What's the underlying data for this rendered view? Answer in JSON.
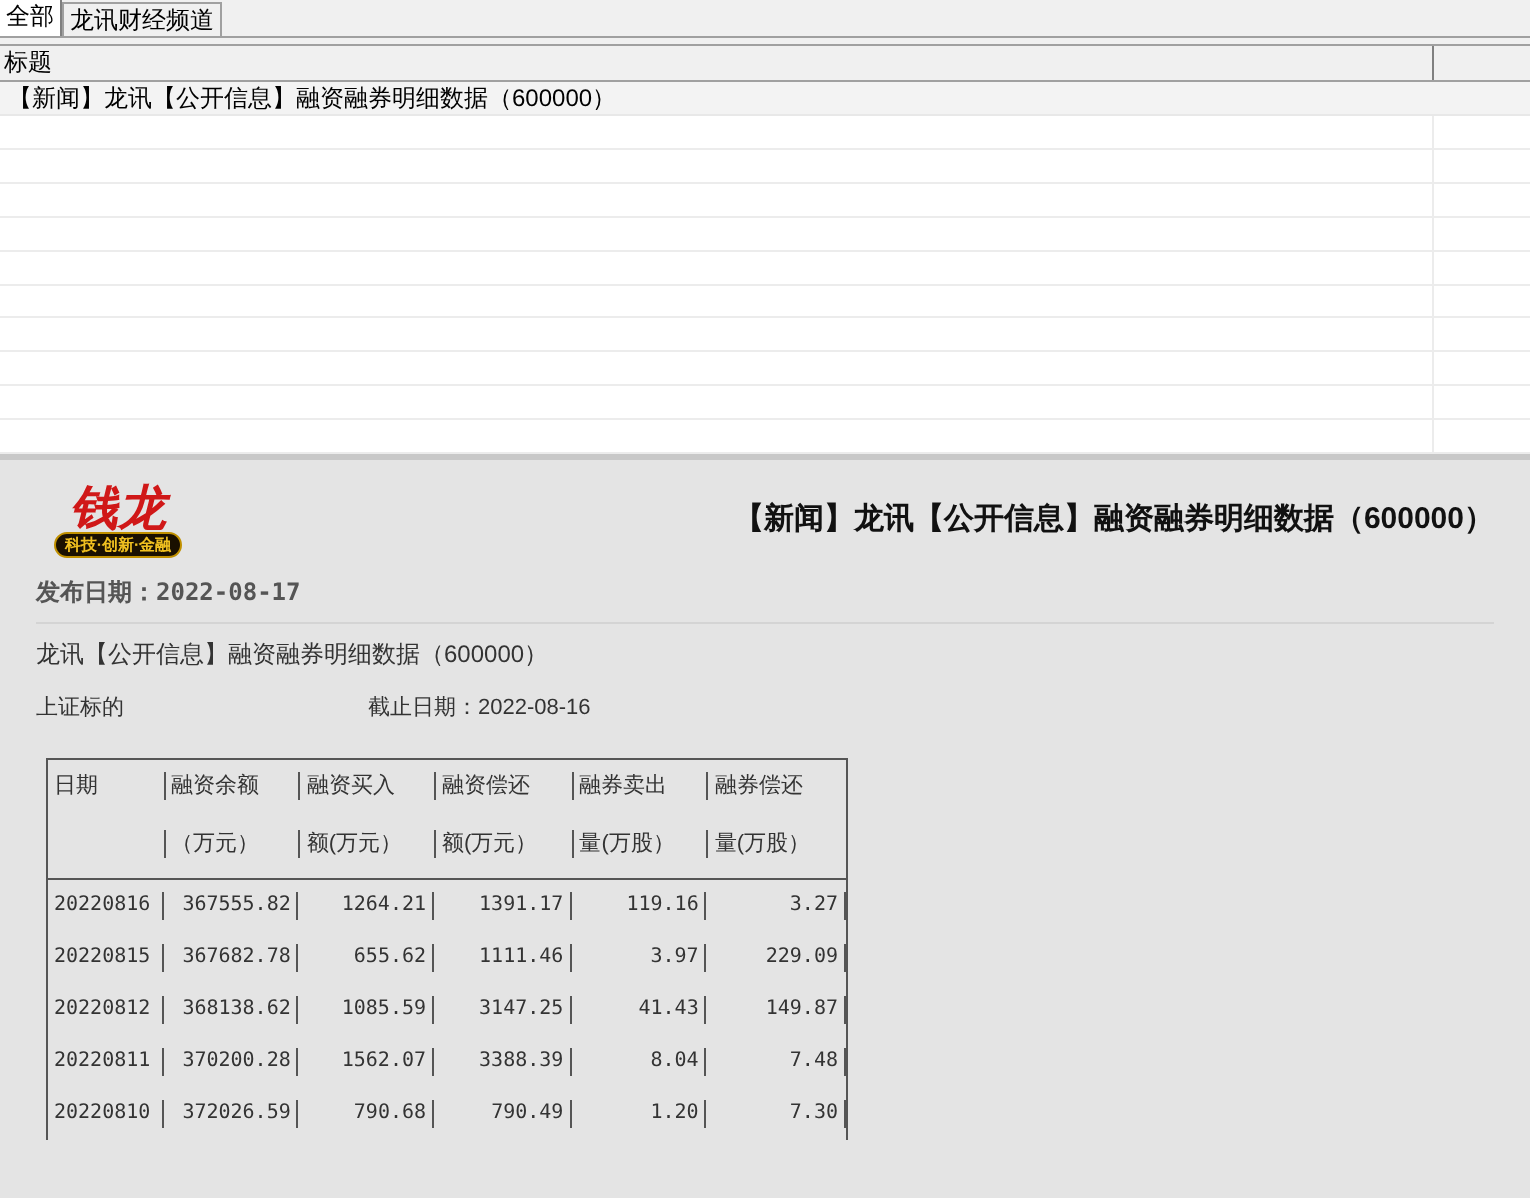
{
  "tabs": [
    {
      "label": "全部",
      "selected": true
    },
    {
      "label": "龙讯财经频道",
      "selected": false
    }
  ],
  "list": {
    "columns": [
      "标题"
    ],
    "rows": [
      {
        "title": "【新闻】龙讯【公开信息】融资融券明细数据（600000）"
      }
    ]
  },
  "article": {
    "logo": {
      "mark": "钱龙",
      "slogan": "科技·创新·金融"
    },
    "headline": "【新闻】龙讯【公开信息】融资融券明细数据（600000）",
    "publish_date": "发布日期：2022-08-17",
    "subtitle": "龙讯【公开信息】融资融券明细数据（600000）",
    "market": "上证标的",
    "cutoff": "截止日期：2022-08-16",
    "table": {
      "columns": [
        {
          "top": "日期"
        },
        {
          "top": "融资余额",
          "bottom": "（万元）"
        },
        {
          "top": "融资买入",
          "bottom": "额(万元）"
        },
        {
          "top": "融资偿还",
          "bottom": "额(万元）"
        },
        {
          "top": "融券卖出",
          "bottom": "量(万股）"
        },
        {
          "top": "融券偿还",
          "bottom": "量(万股）"
        }
      ],
      "rows": [
        [
          "20220816",
          "367555.82",
          "1264.21",
          "1391.17",
          "119.16",
          "3.27"
        ],
        [
          "20220815",
          "367682.78",
          "655.62",
          "1111.46",
          "3.97",
          "229.09"
        ],
        [
          "20220812",
          "368138.62",
          "1085.59",
          "3147.25",
          "41.43",
          "149.87"
        ],
        [
          "20220811",
          "370200.28",
          "1562.07",
          "3388.39",
          "8.04",
          "7.48"
        ],
        [
          "20220810",
          "372026.59",
          "790.68",
          "790.49",
          "1.20",
          "7.30"
        ]
      ]
    }
  }
}
